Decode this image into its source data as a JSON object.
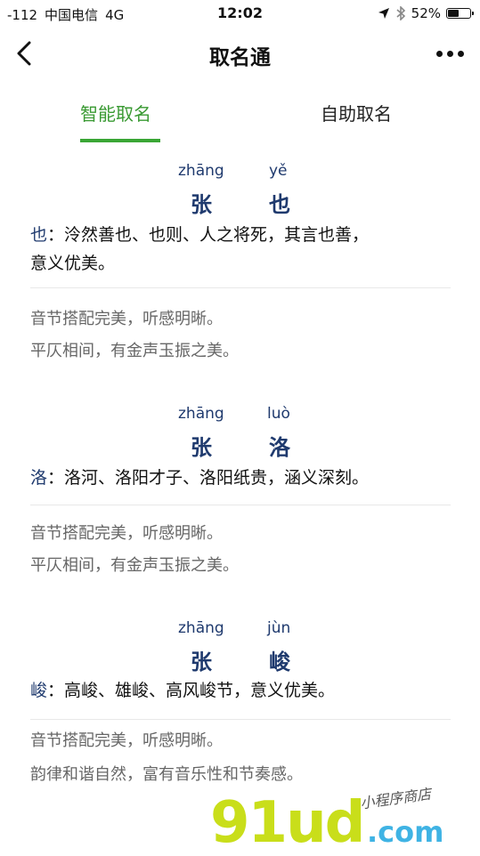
{
  "status": {
    "signal": "-112",
    "carrier": "中国电信",
    "network": "4G",
    "time": "12:02",
    "battery": "52%",
    "battery_level": 0.52
  },
  "nav": {
    "title": "取名通"
  },
  "tabs": [
    {
      "label": "智能取名",
      "active": true
    },
    {
      "label": "自助取名",
      "active": false
    }
  ],
  "names": [
    {
      "pinyin": [
        "zhāng",
        "yě"
      ],
      "chars": [
        "张",
        "也"
      ],
      "meaning_char": "也",
      "meaning_lines": [
        "：泠然善也、也则、人之将死，其言也善，",
        "意义优美。"
      ],
      "notes": [
        "音节搭配完美，听感明晰。",
        "平仄相间，有金声玉振之美。"
      ]
    },
    {
      "pinyin": [
        "zhāng",
        "luò"
      ],
      "chars": [
        "张",
        "洛"
      ],
      "meaning_char": "洛",
      "meaning_lines": [
        "：洛河、洛阳才子、洛阳纸贵，涵义深刻。"
      ],
      "notes": [
        "音节搭配完美，听感明晰。",
        "平仄相间，有金声玉振之美。"
      ]
    },
    {
      "pinyin": [
        "zhāng",
        "jùn"
      ],
      "chars": [
        "张",
        "峻"
      ],
      "meaning_char": "峻",
      "meaning_lines": [
        "：高峻、雄峻、高风峻节，意义优美。"
      ],
      "notes": [
        "音节搭配完美，听感明晰。",
        "韵律和谐自然，富有音乐性和节奏感。"
      ]
    }
  ],
  "watermark": {
    "brand": "91ud",
    "suffix": ".com",
    "tagline": "小程序商店"
  }
}
